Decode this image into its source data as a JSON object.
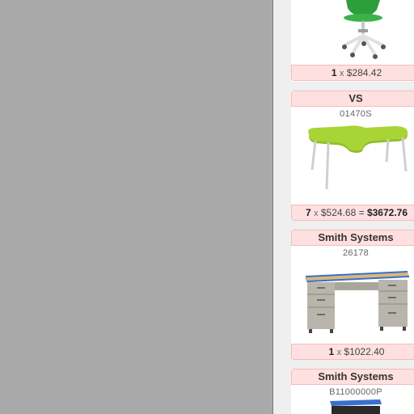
{
  "cart": {
    "items": [
      {
        "brand": "",
        "sku": "",
        "image": "green-task-chair",
        "qty": "1",
        "times": "x",
        "price": "$284.42",
        "equals": "",
        "total": ""
      },
      {
        "brand": "VS",
        "sku": "01470S",
        "image": "green-kidney-table",
        "qty": "7",
        "times": "x",
        "price": "$524.68",
        "equals": "=",
        "total": "$3672.76"
      },
      {
        "brand": "Smith Systems",
        "sku": "26178",
        "image": "double-pedestal-teacher-desk",
        "qty": "1",
        "times": "x",
        "price": "$1022.40",
        "equals": "",
        "total": ""
      },
      {
        "brand": "Smith Systems",
        "sku": "B11000000P",
        "image": "blue-product-partial",
        "qty": "",
        "times": "",
        "price": "",
        "equals": "",
        "total": ""
      }
    ]
  },
  "colors": {
    "canvas": "#a9a9a9",
    "panel": "#efefef",
    "header_bg": "#ffe0e0",
    "chair_green": "#2e9e3c",
    "table_green": "#a9d435",
    "desk_blue": "#3a6fd0"
  }
}
